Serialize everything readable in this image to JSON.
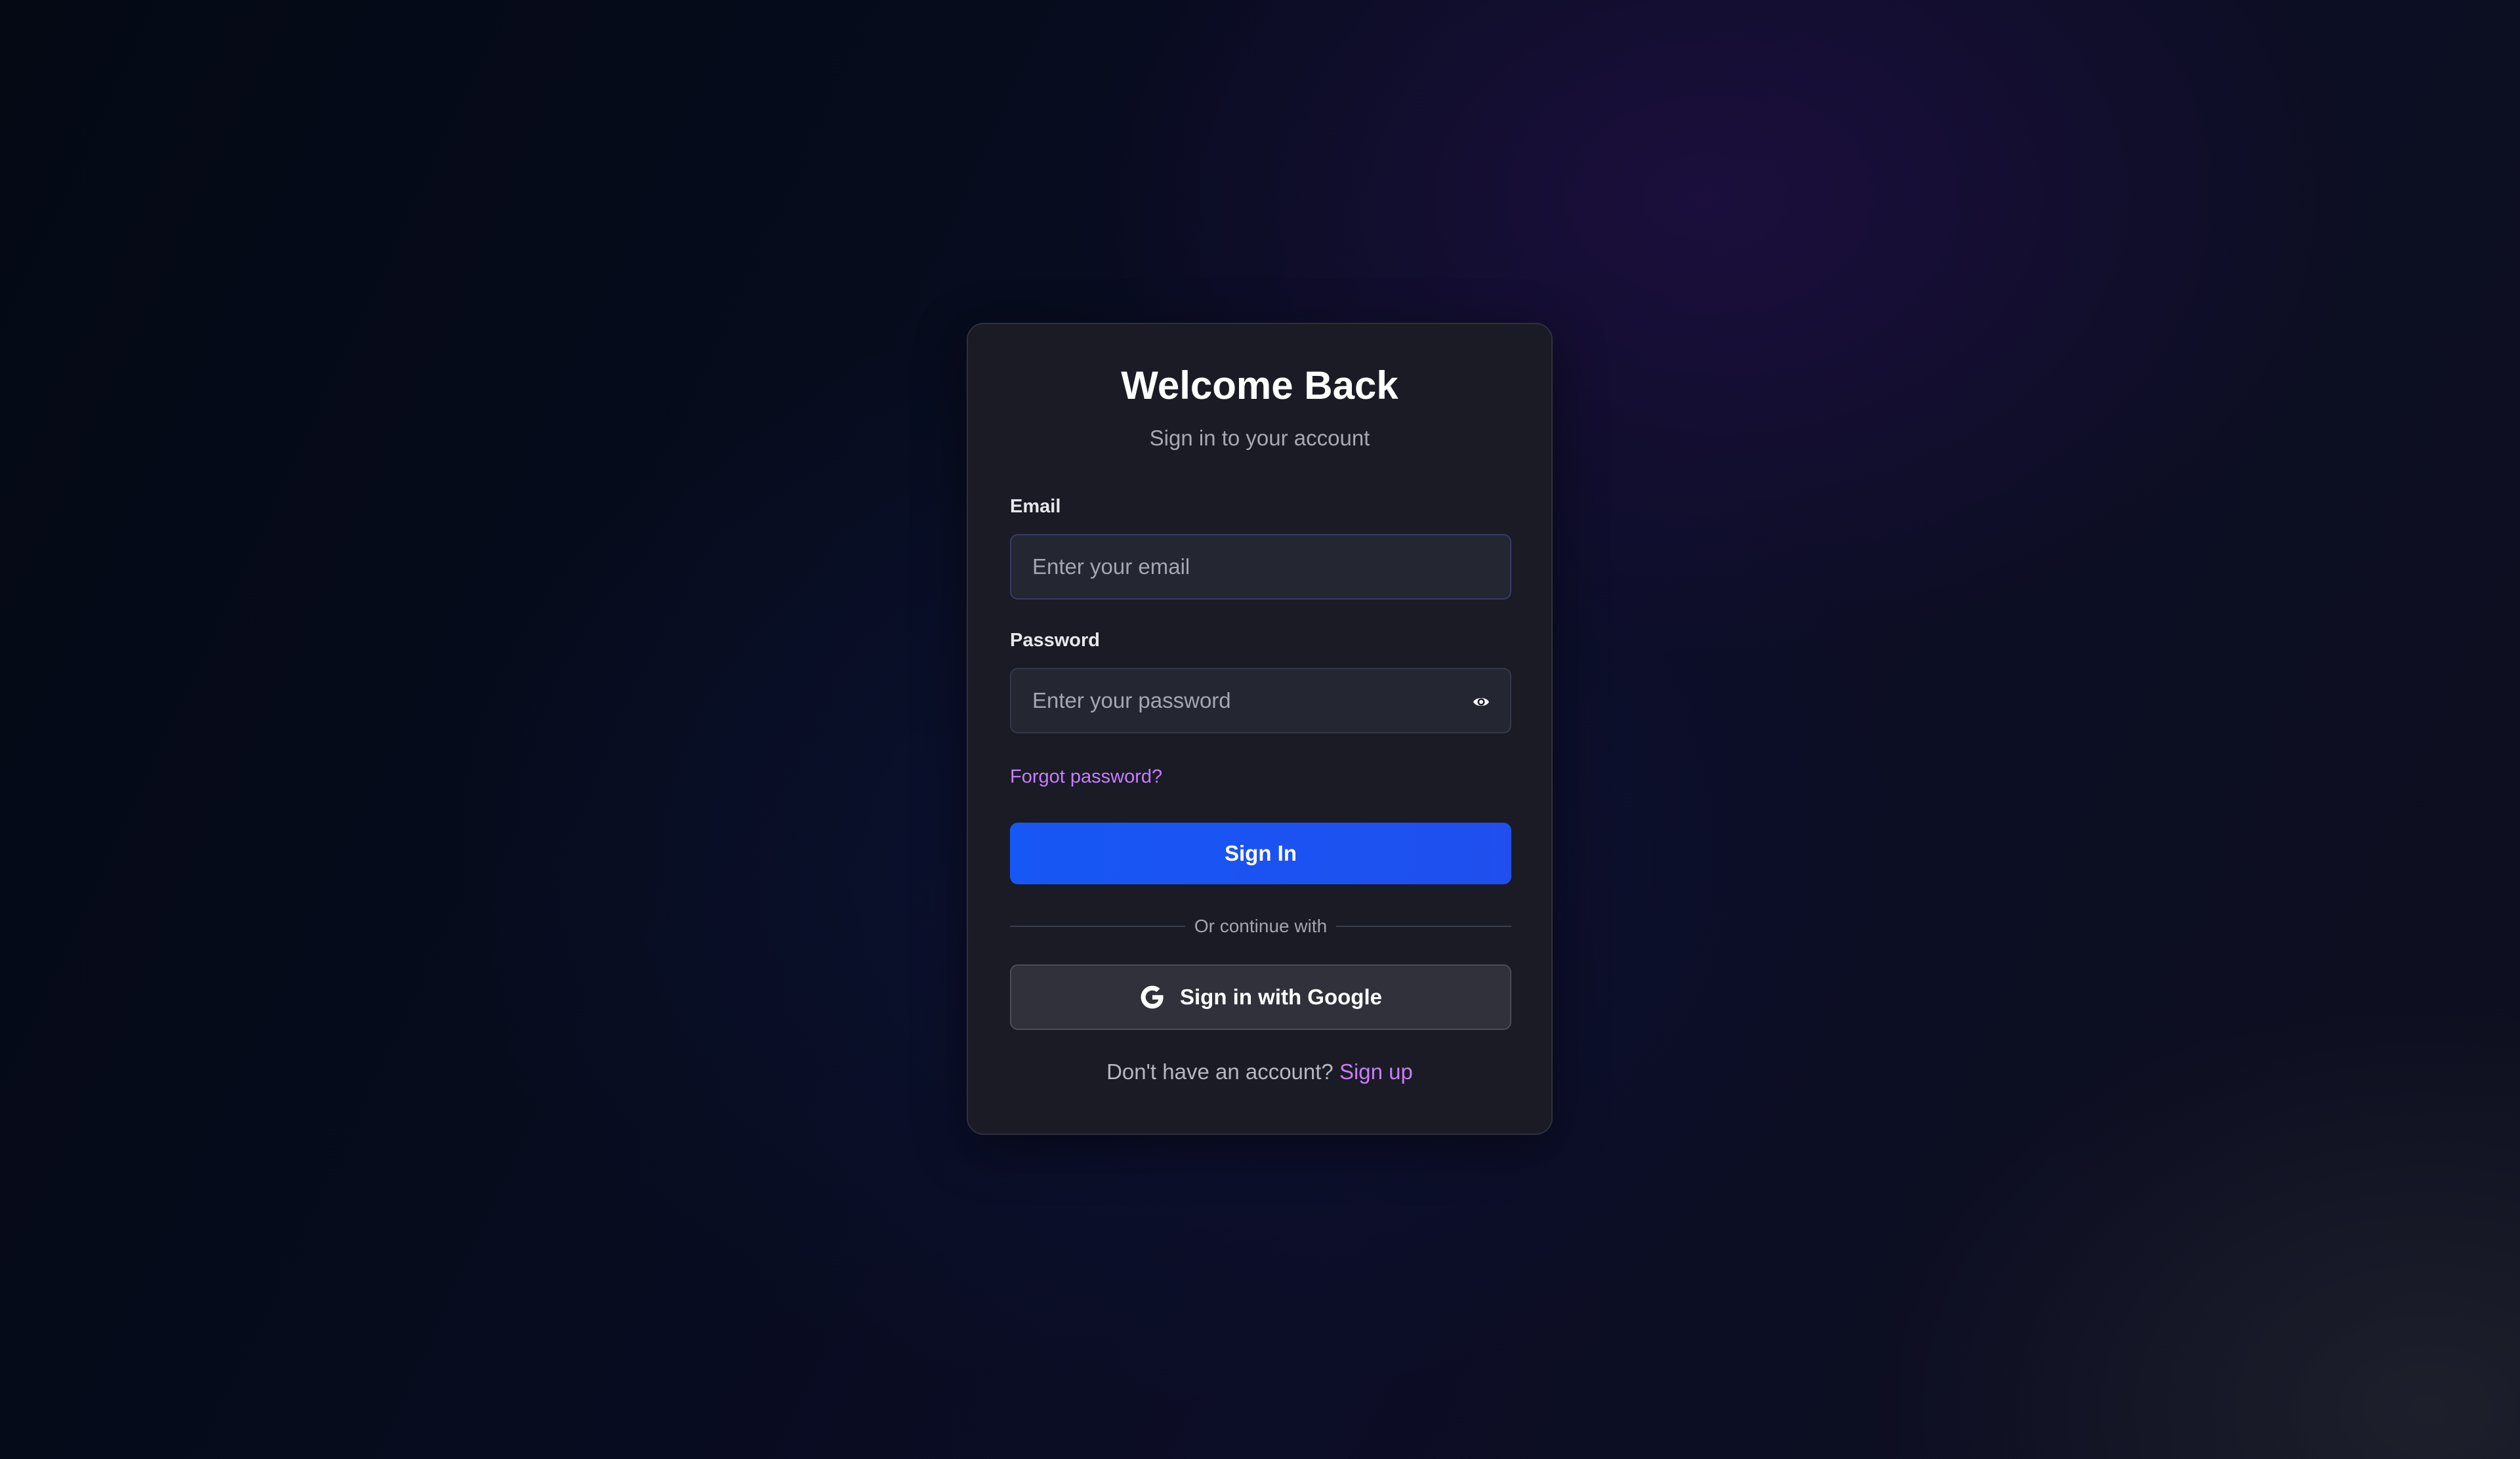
{
  "login": {
    "title": "Welcome Back",
    "subtitle": "Sign in to your account",
    "email": {
      "label": "Email",
      "placeholder": "Enter your email",
      "value": ""
    },
    "password": {
      "label": "Password",
      "placeholder": "Enter your password",
      "value": "",
      "toggle_icon": "eye-icon"
    },
    "forgot_password": "Forgot password?",
    "signin_button": "Sign In",
    "divider_text": "Or continue with",
    "google_button": {
      "label": "Sign in with Google",
      "icon": "google-icon"
    },
    "signup_prompt": "Don't have an account?",
    "signup_link": "Sign up"
  },
  "colors": {
    "background": "#050a18",
    "card": "#1a1b24",
    "primary_button": "#1757f5",
    "link": "#c77dff",
    "google_button": "#30313b"
  }
}
